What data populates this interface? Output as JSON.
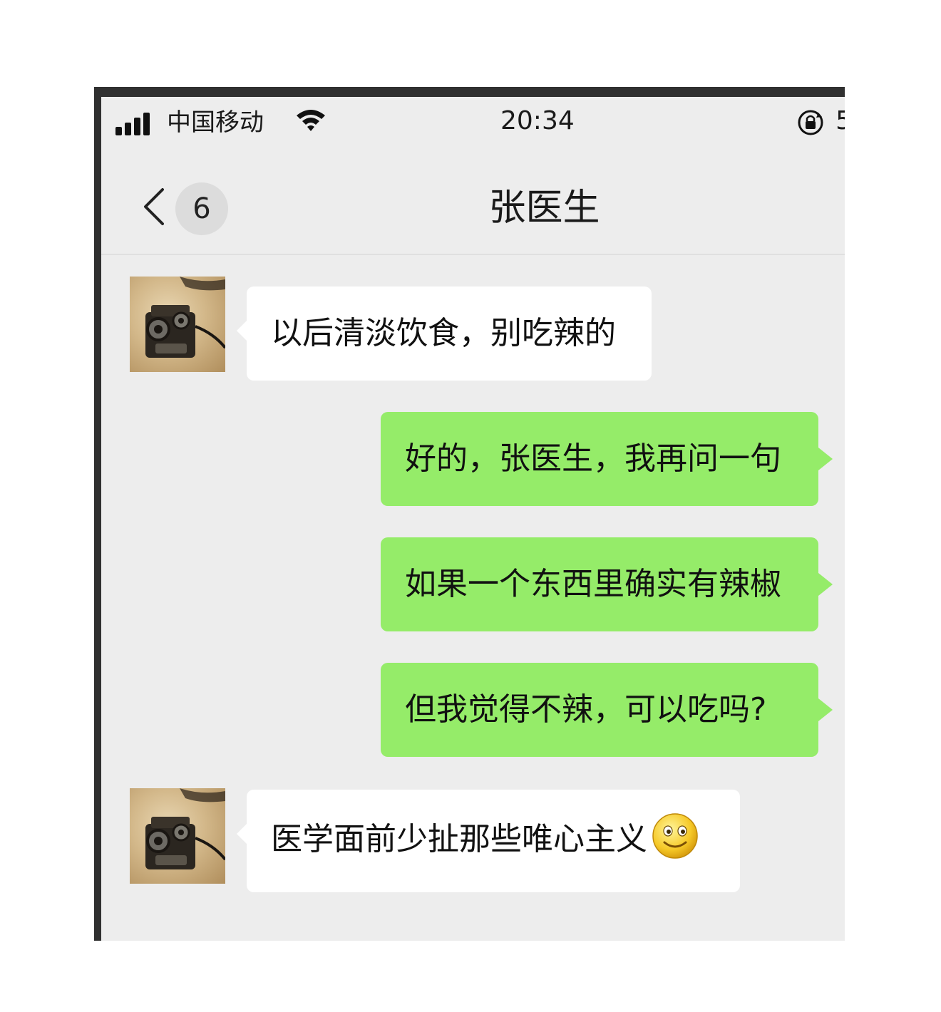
{
  "status_bar": {
    "carrier": "中国移动",
    "time": "20:34",
    "battery_partial": "5"
  },
  "nav": {
    "unread_count": "6",
    "title": "张医生"
  },
  "messages": [
    {
      "direction": "incoming",
      "text": "以后清淡饮食，别吃辣的"
    },
    {
      "direction": "outgoing",
      "text": "好的，张医生，我再问一句"
    },
    {
      "direction": "outgoing",
      "text": "如果一个东西里确实有辣椒"
    },
    {
      "direction": "outgoing",
      "text": "但我觉得不辣，可以吃吗?"
    },
    {
      "direction": "incoming",
      "text": "医学面前少扯那些唯心主义",
      "emoji": "smiley-icon"
    }
  ],
  "colors": {
    "chat_background": "#ededed",
    "outgoing_bubble": "#95ec69",
    "incoming_bubble": "#ffffff",
    "badge": "#dcdcdc"
  }
}
